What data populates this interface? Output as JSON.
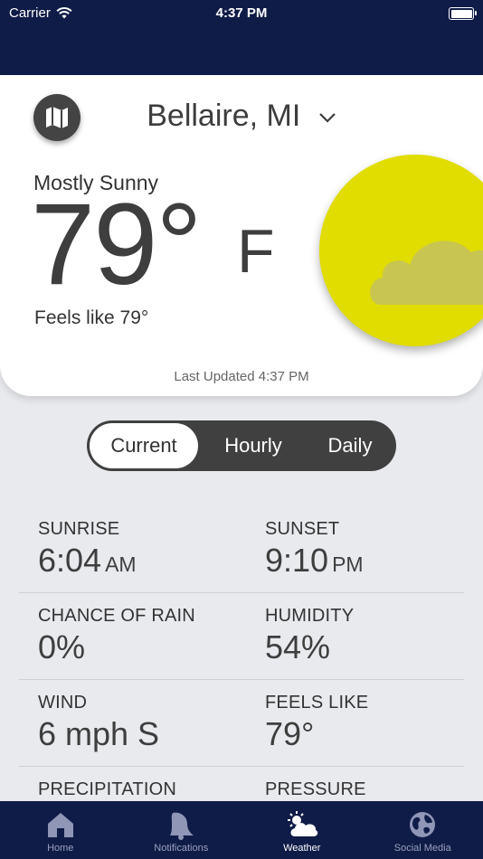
{
  "status_bar": {
    "carrier": "Carrier",
    "time": "4:37 PM"
  },
  "location": {
    "name": "Bellaire, MI"
  },
  "current": {
    "condition": "Mostly Sunny",
    "temperature": "79°",
    "unit": "F",
    "feels_like_text": "Feels like 79°",
    "last_updated": "Last Updated 4:37 PM",
    "icon": "partly-cloudy-sun"
  },
  "segments": [
    {
      "label": "Current",
      "active": true
    },
    {
      "label": "Hourly",
      "active": false
    },
    {
      "label": "Daily",
      "active": false
    }
  ],
  "details": [
    {
      "left": {
        "label": "SUNRISE",
        "value": "6:04",
        "suffix": "AM"
      },
      "right": {
        "label": "SUNSET",
        "value": "9:10",
        "suffix": "PM"
      }
    },
    {
      "left": {
        "label": "CHANCE OF RAIN",
        "value": "0%"
      },
      "right": {
        "label": "HUMIDITY",
        "value": "54%"
      }
    },
    {
      "left": {
        "label": "WIND",
        "value": "6 mph S"
      },
      "right": {
        "label": "FEELS LIKE",
        "value": "79°"
      }
    },
    {
      "left": {
        "label": "PRECIPITATION",
        "value": ""
      },
      "right": {
        "label": "PRESSURE",
        "value": ""
      }
    }
  ],
  "tabbar": [
    {
      "label": "Home",
      "icon": "home-icon",
      "active": false
    },
    {
      "label": "Notifications",
      "icon": "bell-icon",
      "active": false
    },
    {
      "label": "Weather",
      "icon": "weather-icon",
      "active": true
    },
    {
      "label": "Social Media",
      "icon": "globe-icon",
      "active": false
    }
  ],
  "colors": {
    "header": "#0f1c47",
    "sun": "#e1dd00",
    "cloud": "#c8c650",
    "segment_bg": "#404040",
    "background": "#e9eaee"
  }
}
